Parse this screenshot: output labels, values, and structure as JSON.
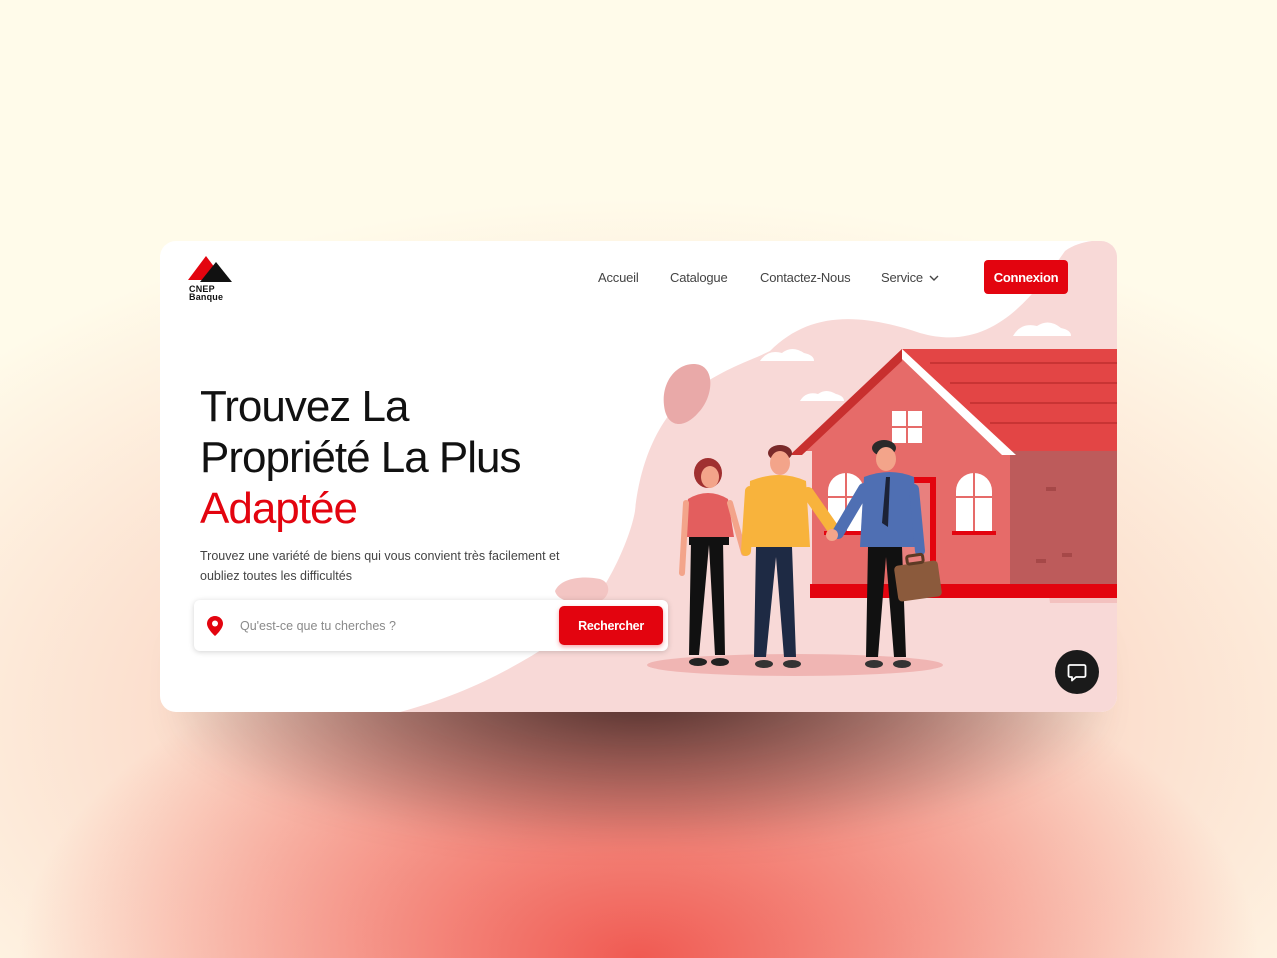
{
  "brand": {
    "line1": "CNEP",
    "line2": "Banque"
  },
  "nav": {
    "accueil": "Accueil",
    "catalogue": "Catalogue",
    "contact": "Contactez-Nous",
    "service": "Service",
    "connexion": "Connexion"
  },
  "hero": {
    "line1": "Trouvez La",
    "line2": "Propriété La Plus",
    "line3": "Adaptée",
    "subtitle": "Trouvez une variété de biens qui vous convient très facilement et oubliez toutes les difficultés"
  },
  "search": {
    "placeholder": "Qu'est-ce que tu cherches ?",
    "button": "Rechercher"
  },
  "icons": [
    "cnep-logo-icon",
    "chevron-down-icon",
    "location-pin-icon",
    "chat-icon"
  ],
  "colors": {
    "accent": "#e3040f",
    "pink_bg": "#f7d5d3",
    "house": "#e66b69"
  }
}
